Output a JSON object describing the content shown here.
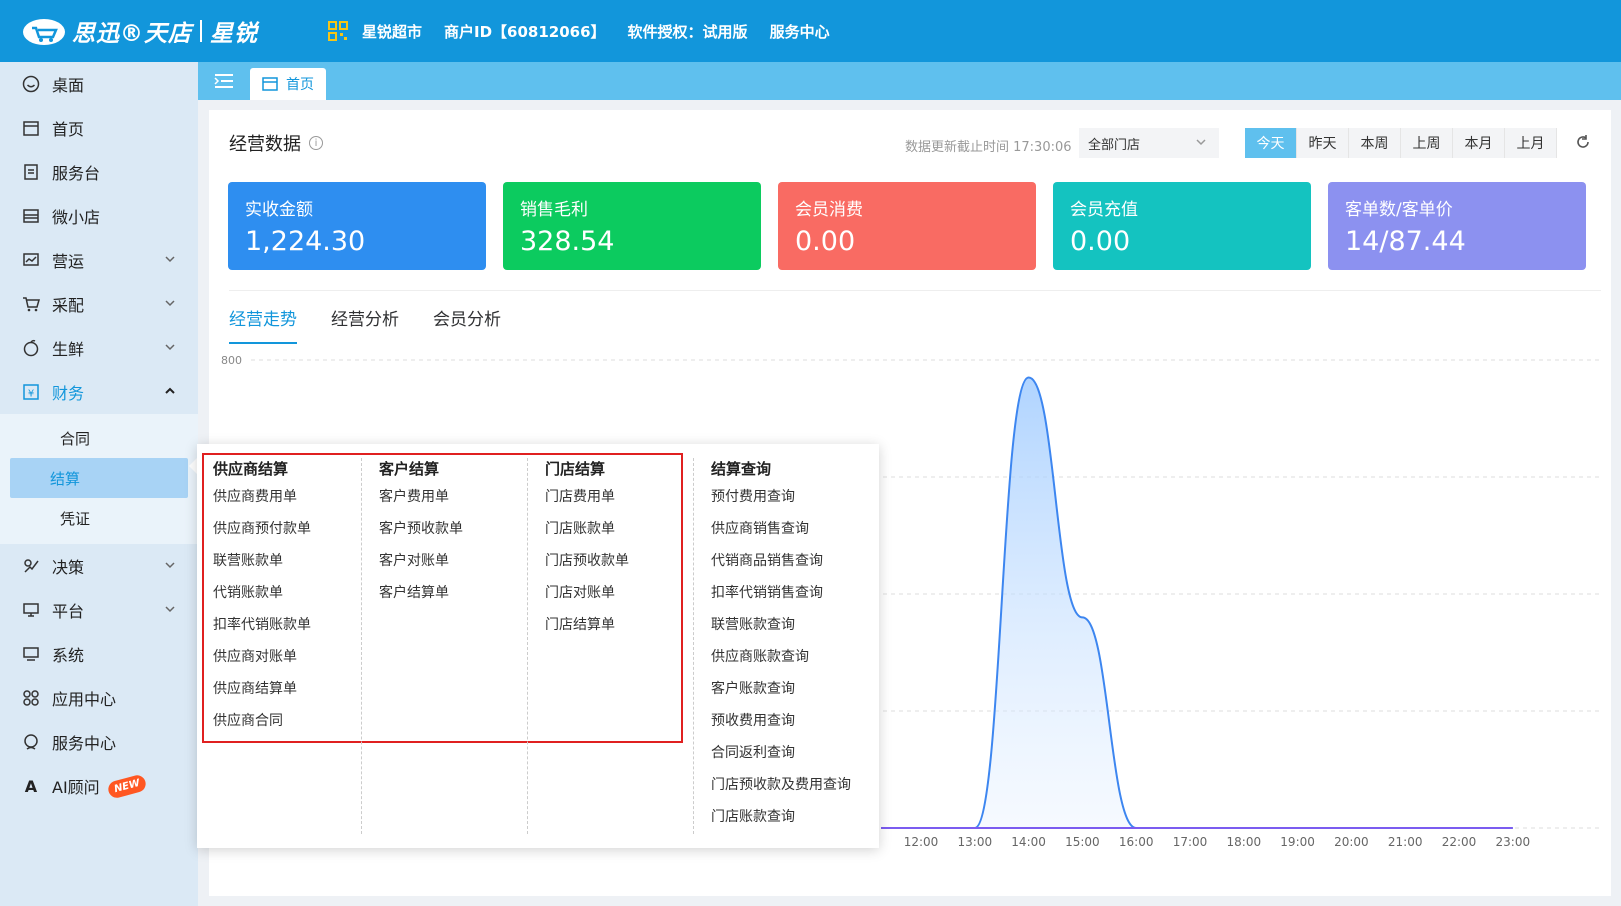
{
  "header": {
    "logo_text": "思迅®天店",
    "product": "星锐",
    "nav": [
      "星锐超市",
      "商户ID【60812066】",
      "软件授权：试用版",
      "服务中心"
    ]
  },
  "sidebar": {
    "items": [
      {
        "label": "桌面",
        "icon": "smile-icon"
      },
      {
        "label": "首页",
        "icon": "store-icon"
      },
      {
        "label": "服务台",
        "icon": "document-icon"
      },
      {
        "label": "微小店",
        "icon": "shop-icon"
      },
      {
        "label": "营运",
        "icon": "chart-icon",
        "arrow": "down"
      },
      {
        "label": "采配",
        "icon": "cart-icon",
        "arrow": "down"
      },
      {
        "label": "生鲜",
        "icon": "fresh-icon",
        "arrow": "down"
      },
      {
        "label": "财务",
        "icon": "yuan-icon",
        "arrow": "up"
      }
    ],
    "finance_sub": [
      "合同",
      "结算",
      "凭证"
    ],
    "items_after": [
      {
        "label": "决策",
        "icon": "decision-icon",
        "arrow": "down"
      },
      {
        "label": "平台",
        "icon": "platform-icon",
        "arrow": "down"
      },
      {
        "label": "系统",
        "icon": "system-icon"
      },
      {
        "label": "应用中心",
        "icon": "apps-icon"
      },
      {
        "label": "服务中心",
        "icon": "service-icon"
      }
    ],
    "ai_label": "AI顾问",
    "ai_badge": "NEW"
  },
  "tabs": {
    "home_tab": "首页"
  },
  "panel": {
    "title": "经营数据",
    "update_time": "数据更新截止时间 17:30:06",
    "store_select": "全部门店",
    "date_ranges": [
      "今天",
      "昨天",
      "本周",
      "上周",
      "本月",
      "上月"
    ],
    "active_range": "今天"
  },
  "cards": [
    {
      "label": "实收金额",
      "value": "1,224.30",
      "color": "#2e8ef0"
    },
    {
      "label": "销售毛利",
      "value": "328.54",
      "color": "#0ccb5f"
    },
    {
      "label": "会员消费",
      "value": "0.00",
      "color": "#f96b63"
    },
    {
      "label": "会员充值",
      "value": "0.00",
      "color": "#14c3c0"
    },
    {
      "label": "客单数/客单价",
      "value": "14/87.44",
      "color": "#8c91f0"
    }
  ],
  "subtabs": [
    "经营走势",
    "经营分析",
    "会员分析"
  ],
  "chart_data": {
    "type": "area",
    "ylabel_top": "800",
    "x": [
      "12:00",
      "13:00",
      "14:00",
      "15:00",
      "16:00",
      "17:00",
      "18:00",
      "19:00",
      "20:00",
      "21:00",
      "22:00",
      "23:00"
    ],
    "values": [
      0,
      0,
      770,
      360,
      0,
      0,
      0,
      0,
      0,
      0,
      0,
      0
    ],
    "ylim": [
      0,
      800
    ]
  },
  "flyout": {
    "columns": [
      {
        "title": "供应商结算",
        "items": [
          "供应商费用单",
          "供应商预付款单",
          "联营账款单",
          "代销账款单",
          "扣率代销账款单",
          "供应商对账单",
          "供应商结算单",
          "供应商合同"
        ]
      },
      {
        "title": "客户结算",
        "items": [
          "客户费用单",
          "客户预收款单",
          "客户对账单",
          "客户结算单"
        ]
      },
      {
        "title": "门店结算",
        "items": [
          "门店费用单",
          "门店账款单",
          "门店预收款单",
          "门店对账单",
          "门店结算单"
        ]
      },
      {
        "title": "结算查询",
        "items": [
          "预付费用查询",
          "供应商销售查询",
          "代销商品销售查询",
          "扣率代销销售查询",
          "联营账款查询",
          "供应商账款查询",
          "客户账款查询",
          "预收费用查询",
          "合同返利查询",
          "门店预收款及费用查询",
          "门店账款查询"
        ]
      }
    ]
  }
}
